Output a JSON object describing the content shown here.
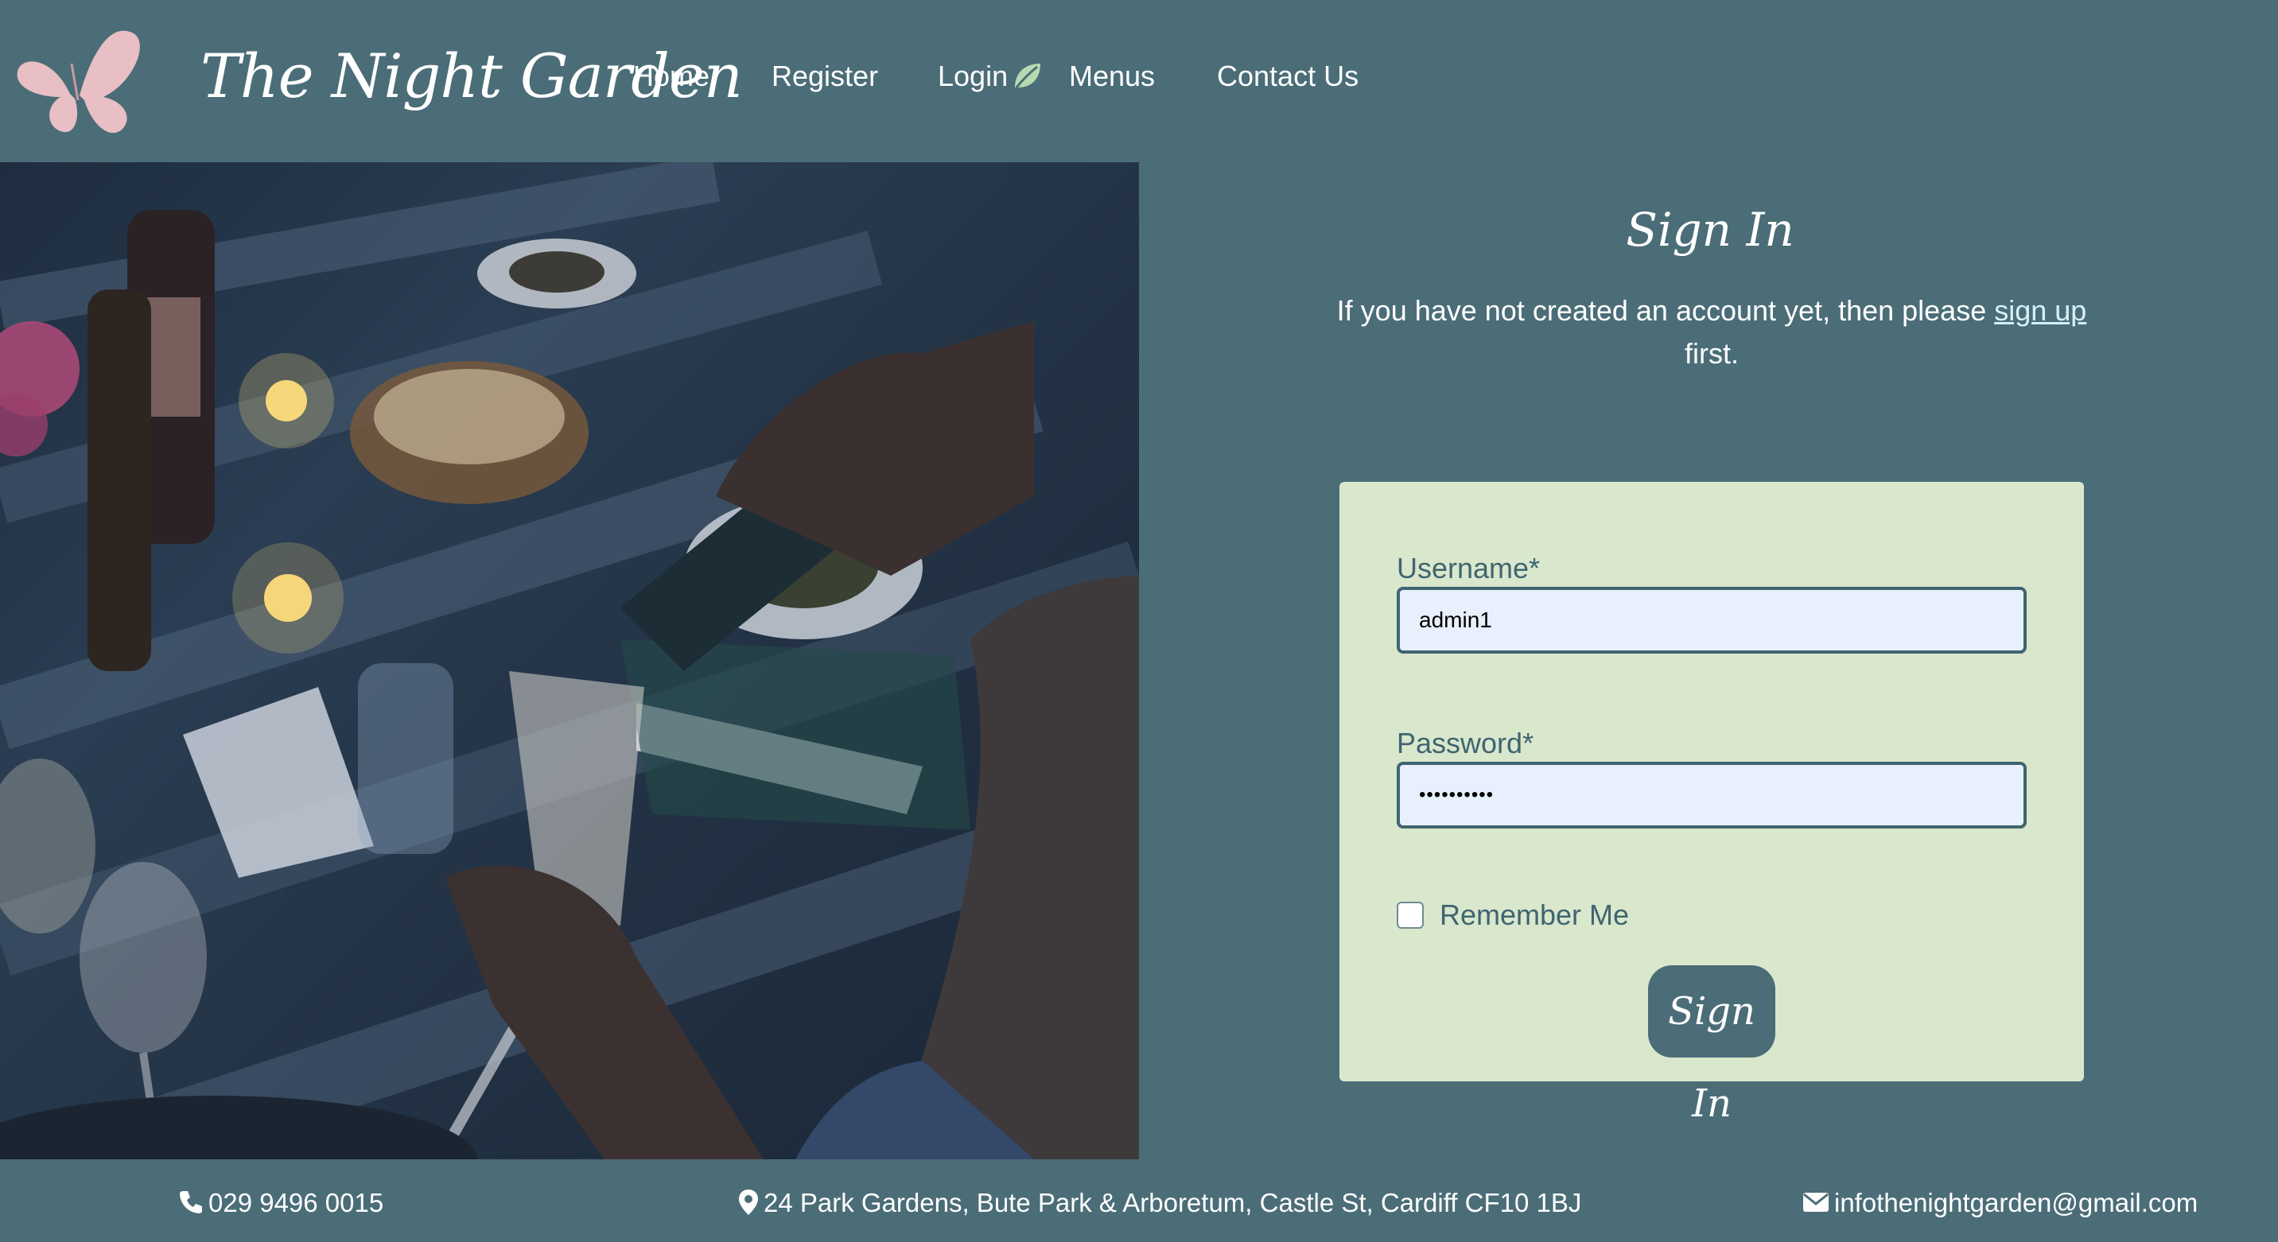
{
  "header": {
    "brand": "The Night Garden",
    "logo_icon": "butterfly-icon",
    "nav": [
      {
        "label": "Home"
      },
      {
        "label": "Register"
      },
      {
        "label": "Login",
        "icon": "leaf-icon"
      },
      {
        "label": "Menus"
      },
      {
        "label": "Contact Us"
      }
    ]
  },
  "hero": {
    "image": "dinner-table-wine-pouring-photo"
  },
  "signin": {
    "title": "Sign In",
    "intro_before": "If you have not created an account yet, then please ",
    "intro_link": "sign up",
    "intro_after": " first.",
    "username_label": "Username*",
    "username_value": "admin1",
    "password_label": "Password*",
    "password_value": "••••••••••",
    "remember_label": "Remember Me",
    "remember_checked": false,
    "submit_label": "Sign In"
  },
  "footer": {
    "phone": "029 9496 0015",
    "phone_icon": "phone-icon",
    "address": "24 Park Gardens, Bute Park & Arboretum, Castle St, Cardiff CF10 1BJ",
    "address_icon": "map-pin-icon",
    "email": "infothenightgarden@gmail.com",
    "email_icon": "envelope-icon"
  },
  "colors": {
    "background": "#4b6d78",
    "card": "#d9e7cd",
    "accent_text": "#3f6570",
    "input_bg": "#e8f0fd",
    "logo_pink": "#e8bfc4"
  }
}
